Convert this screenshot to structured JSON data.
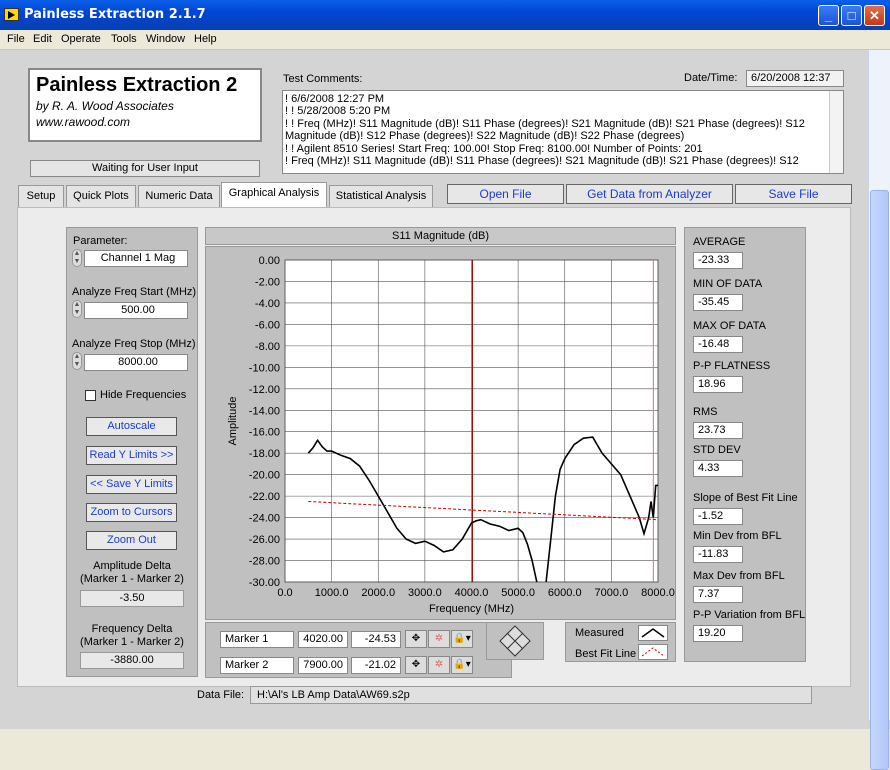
{
  "window": {
    "title": "Painless Extraction 2.1.7",
    "buttons": {
      "minimize": "_",
      "maximize": "□",
      "close": "✕"
    }
  },
  "menu": [
    "File",
    "Edit",
    "Operate",
    "Tools",
    "Window",
    "Help"
  ],
  "logo": {
    "title": "Painless Extraction 2",
    "subtitle": "by R. A. Wood Associates",
    "url": "www.rawood.com"
  },
  "status": "Waiting for User Input",
  "comments": {
    "label": "Test Comments:",
    "lines": [
      "! 6/6/2008 12:27 PM",
      "! ! 5/28/2008 5:20 PM",
      "! ! Freq (MHz)! S11 Magnitude (dB)! S11 Phase (degrees)! S21 Magnitude (dB)! S21 Phase (degrees)! S12 Magnitude (dB)! S12 Phase (degrees)! S22 Magnitude (dB)! S22 Phase (degrees)",
      "! ! Agilent 8510 Series! Start Freq: 100.00! Stop Freq: 8100.00! Number of Points: 201",
      "! Freq (MHz)! S11 Magnitude (dB)! S11 Phase (degrees)! S21 Magnitude (dB)! S21 Phase (degrees)! S12"
    ]
  },
  "datetime": {
    "label": "Date/Time:",
    "value": "6/20/2008  12:37"
  },
  "tabs": [
    "Setup",
    "Quick Plots",
    "Numeric Data",
    "Graphical Analysis",
    "Statistical Analysis"
  ],
  "top_buttons": {
    "open": "Open File",
    "get": "Get Data from Analyzer",
    "save": "Save File"
  },
  "left": {
    "parameter_label": "Parameter:",
    "parameter_value": "Channel 1 Mag",
    "start_label": "Analyze Freq Start (MHz)",
    "start_value": "500.00",
    "stop_label": "Analyze Freq Stop (MHz)",
    "stop_value": "8000.00",
    "hide_label": "Hide Frequencies",
    "buttons": [
      "Autoscale",
      "Read Y Limits >>",
      "<< Save Y Limits",
      "Zoom to Cursors",
      "Zoom Out"
    ],
    "amp_delta_label1": "Amplitude Delta",
    "amp_delta_label2": "(Marker 1 - Marker 2)",
    "amp_delta_value": "-3.50",
    "freq_delta_label1": "Frequency Delta",
    "freq_delta_label2": "(Marker 1 - Marker 2)",
    "freq_delta_value": "-3880.00"
  },
  "stats": [
    {
      "label": "AVERAGE",
      "value": "-23.33"
    },
    {
      "label": "MIN OF DATA",
      "value": "-35.45"
    },
    {
      "label": "MAX OF DATA",
      "value": "-16.48"
    },
    {
      "label": "P-P FLATNESS",
      "value": "18.96"
    },
    {
      "label": "RMS",
      "value": "23.73"
    },
    {
      "label": "STD DEV",
      "value": "4.33"
    },
    {
      "label": "Slope of Best Fit Line",
      "value": "-1.52"
    },
    {
      "label": "Min Dev from BFL",
      "value": "-11.83"
    },
    {
      "label": "Max Dev from BFL",
      "value": "7.37"
    },
    {
      "label": "P-P Variation from BFL",
      "value": "19.20"
    }
  ],
  "markers": [
    {
      "name": "Marker 1",
      "freq": "4020.00",
      "amp": "-24.53"
    },
    {
      "name": "Marker 2",
      "freq": "7900.00",
      "amp": "-21.02"
    }
  ],
  "legend": {
    "measured": "Measured",
    "bfl": "Best Fit Line"
  },
  "datafile": {
    "label": "Data File:",
    "value": "H:\\Al's LB Amp Data\\AW69.s2p"
  },
  "colors": {
    "measured": "#000000",
    "bfl": "#cc0000",
    "marker": "#8b0000"
  },
  "chart_data": {
    "type": "line",
    "title": "S11 Magnitude (dB)",
    "xlabel": "Frequency (MHz)",
    "ylabel": "Amplitude",
    "xlim": [
      0,
      8000
    ],
    "ylim": [
      -30,
      0
    ],
    "xticks": [
      "0.0",
      "1000.0",
      "2000.0",
      "3000.0",
      "4000.0",
      "5000.0",
      "6000.0",
      "7000.0",
      "8000.0"
    ],
    "yticks": [
      "0.00",
      "-2.00",
      "-4.00",
      "-6.00",
      "-8.00",
      "-10.00",
      "-12.00",
      "-14.00",
      "-16.00",
      "-18.00",
      "-20.00",
      "-22.00",
      "-24.00",
      "-26.00",
      "-28.00",
      "-30.00"
    ],
    "grid": true,
    "series": [
      {
        "name": "Measured",
        "x": [
          500,
          600,
          700,
          800,
          900,
          1000,
          1200,
          1400,
          1600,
          1800,
          2000,
          2200,
          2400,
          2600,
          2800,
          3000,
          3200,
          3400,
          3600,
          3800,
          4000,
          4100,
          4200,
          4400,
          4600,
          4800,
          5000,
          5100,
          5200,
          5300,
          5400,
          5500,
          5600,
          5700,
          5800,
          5900,
          6000,
          6200,
          6400,
          6600,
          6800,
          7000,
          7200,
          7400,
          7600,
          7700,
          7800,
          7850,
          7900,
          7950,
          8000
        ],
        "y": [
          -18.0,
          -17.5,
          -16.8,
          -17.4,
          -17.8,
          -17.8,
          -18.2,
          -18.5,
          -19.2,
          -20.5,
          -22.0,
          -23.5,
          -25.0,
          -26.0,
          -26.4,
          -26.2,
          -26.6,
          -27.2,
          -27.0,
          -26.0,
          -24.5,
          -24.3,
          -24.2,
          -24.6,
          -24.8,
          -25.2,
          -25.0,
          -25.4,
          -26.5,
          -28.0,
          -30.0,
          -32.0,
          -30.0,
          -26.0,
          -22.0,
          -19.5,
          -18.5,
          -17.2,
          -16.6,
          -16.5,
          -18.0,
          -19.0,
          -20.0,
          -22.0,
          -24.0,
          -25.5,
          -24.0,
          -22.5,
          -24.0,
          -21.0,
          -21.0
        ]
      },
      {
        "name": "Best Fit Line",
        "x": [
          500,
          8000
        ],
        "y": [
          -22.5,
          -24.2
        ]
      }
    ],
    "markers": [
      {
        "name": "Marker 1",
        "x": 4020
      },
      {
        "name": "Marker 2",
        "x": 7900
      }
    ]
  }
}
